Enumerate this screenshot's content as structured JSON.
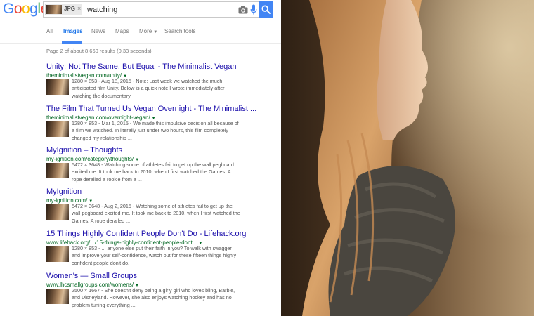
{
  "logo": {
    "letters": [
      "G",
      "o",
      "o",
      "g",
      "l",
      "e"
    ],
    "colors": [
      "#4285f4",
      "#ea4335",
      "#fbbc05",
      "#4285f4",
      "#34a853",
      "#ea4335"
    ]
  },
  "search": {
    "chip_label": "JPG",
    "chip_close": "×",
    "query": "watching",
    "accent": "#4285f4"
  },
  "tabs": [
    "All",
    "Images",
    "News",
    "Maps",
    "More",
    "Search tools"
  ],
  "stats": "Page 2 of about 8,660 results (0.33 seconds)",
  "results": [
    {
      "title": "Unity: Not The Same, But Equal - The Minimalist Vegan",
      "url": "theminimalistvegan.com/unity/",
      "snippet": "1280 × 853 - Aug 18, 2015 - Note: Last week we watched the much anticipated film Unity. Below is a quick note I wrote immediately after watching the documentary."
    },
    {
      "title": "The Film That Turned Us Vegan Overnight - The Minimalist ...",
      "url": "theminimalistvegan.com/overnight-vegan/",
      "snippet": "1280 × 853 - Mar 1, 2015 - We made this impulsive decision all because of a film we watched. In literally just under two hours, this film completely changed my relationship ..."
    },
    {
      "title": "MyIgnition – Thoughts",
      "url": "my-ignition.com/category/thoughts/",
      "snippet": "5472 × 3648 - Watching some of athletes fail to get up the wall pegboard excited me. It took me back to 2010, when I first watched the Games. A rope derailed a rookie from a ..."
    },
    {
      "title": "MyIgnition",
      "url": "my-ignition.com/",
      "snippet": "5472 × 3648 - Aug 2, 2015 - Watching some of athletes fail to get up the wall pegboard excited me. It took me back to 2010, when I first watched the Games. A rope derailed ..."
    },
    {
      "title": "15 Things Highly Confident People Don't Do - Lifehack.org",
      "url": "www.lifehack.org/.../15-things-highly-confident-people-dont...",
      "snippet": "1280 × 853 - ... anyone else put their faith in you? To walk with swagger and improve your self-confidence, watch out for these fifteen things highly confident people don't do."
    },
    {
      "title": "Women's — Small Groups",
      "url": "www.lhcsmallgroups.com/womens/",
      "snippet": "2500 × 1667 - She doesn't deny being a girly girl who loves bling, Barbie, and Disneyland. However, she also enjoys watching hockey and has no problem tuning everything ..."
    }
  ]
}
